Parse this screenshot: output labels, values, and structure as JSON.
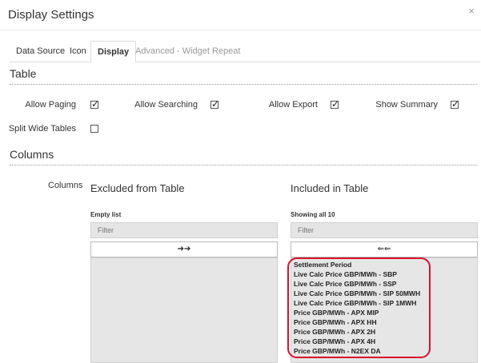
{
  "window": {
    "title": "Display Settings",
    "close_glyph": "×"
  },
  "tabs": [
    {
      "label": "Data Source"
    },
    {
      "label": "Icon"
    },
    {
      "label": "Display"
    },
    {
      "label": "Advanced - Widget Repeat"
    }
  ],
  "table_section": {
    "title": "Table",
    "options": [
      {
        "label": "Allow Paging",
        "checked": true
      },
      {
        "label": "Allow Searching",
        "checked": true
      },
      {
        "label": "Allow Export",
        "checked": true
      },
      {
        "label": "Show Summary",
        "checked": true
      },
      {
        "label": "Split Wide Tables",
        "checked": false
      }
    ]
  },
  "columns_section": {
    "title": "Columns",
    "field_label": "Columns",
    "excluded": {
      "heading": "Excluded from Table",
      "caption": "Empty list",
      "filter_placeholder": "Filter",
      "move_glyph": "➔➔",
      "items": []
    },
    "included": {
      "heading": "Included in Table",
      "caption": "Showing all 10",
      "filter_placeholder": "Filter",
      "move_glyph": "⇐⇐",
      "items": [
        "Settlement Period",
        "Live Calc Price GBP/MWh - SBP",
        "Live Calc Price GBP/MWh - SSP",
        "Live Calc Price GBP/MWh - SIP 50MWH",
        "Live Calc Price GBP/MWh - SIP 1MWH",
        "Price GBP/MWh - APX MIP",
        "Price GBP/MWh - APX HH",
        "Price GBP/MWh - APX 2H",
        "Price GBP/MWh - APX 4H",
        "Price GBP/MWh - N2EX DA"
      ]
    }
  },
  "colors": {
    "highlight": "#d9102a",
    "list_bg": "#e6e6e6"
  }
}
